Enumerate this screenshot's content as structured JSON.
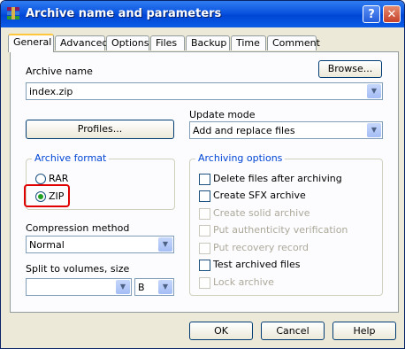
{
  "window": {
    "title": "Archive name and parameters",
    "help_glyph": "?",
    "close_glyph": "✕"
  },
  "tabs": [
    {
      "label": "General"
    },
    {
      "label": "Advanced"
    },
    {
      "label": "Options"
    },
    {
      "label": "Files"
    },
    {
      "label": "Backup"
    },
    {
      "label": "Time"
    },
    {
      "label": "Comment"
    }
  ],
  "general": {
    "archive_name_label": "Archive name",
    "browse_button": "Browse...",
    "archive_name_value": "index.zip",
    "profiles_button": "Profiles...",
    "update_mode_label": "Update mode",
    "update_mode_value": "Add and replace files",
    "archive_format": {
      "title": "Archive format",
      "options": [
        {
          "label": "RAR",
          "selected": false
        },
        {
          "label": "ZIP",
          "selected": true
        }
      ]
    },
    "compression_label": "Compression method",
    "compression_value": "Normal",
    "split_label": "Split to volumes, size",
    "split_value": "",
    "split_unit_value": "B",
    "archiving_options": {
      "title": "Archiving options",
      "items": [
        {
          "label": "Delete files after archiving",
          "enabled": true,
          "checked": false
        },
        {
          "label": "Create SFX archive",
          "enabled": true,
          "checked": false
        },
        {
          "label": "Create solid archive",
          "enabled": false,
          "checked": false
        },
        {
          "label": "Put authenticity verification",
          "enabled": false,
          "checked": false
        },
        {
          "label": "Put recovery record",
          "enabled": false,
          "checked": false
        },
        {
          "label": "Test archived files",
          "enabled": true,
          "checked": false
        },
        {
          "label": "Lock archive",
          "enabled": false,
          "checked": false
        }
      ]
    }
  },
  "buttons": {
    "ok": "OK",
    "cancel": "Cancel",
    "help": "Help"
  },
  "colors": {
    "titlebar": "#0a54e0",
    "highlight": "#e00000",
    "group_title": "#0046d5"
  }
}
